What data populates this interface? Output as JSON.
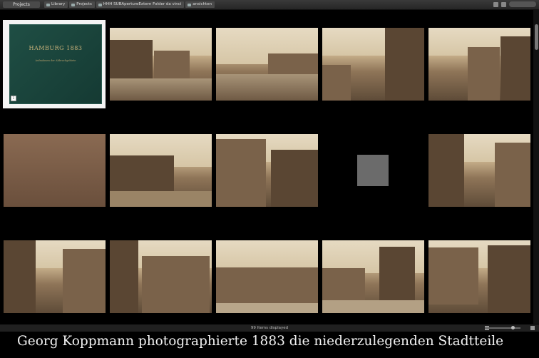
{
  "toolbar": {
    "projects_label": "Projects",
    "breadcrumbs": [
      "Library",
      "Projects",
      "HHH SUBApertureExtern Folder da vinci",
      "ansichten"
    ]
  },
  "book": {
    "title": "HAMBURG 1883",
    "subtitle": "Aufnahmen der Abbruchgebiete",
    "badge": "1"
  },
  "status": {
    "items_displayed": "99 Items displayed"
  },
  "caption": "Georg Koppmann photographierte 1883 die niederzulegenden Stadtteile",
  "colors": {
    "background": "#000000",
    "toolbar": "#2e2e2e",
    "sepia": "#cbb48f",
    "book_green": "#1f4e44"
  }
}
